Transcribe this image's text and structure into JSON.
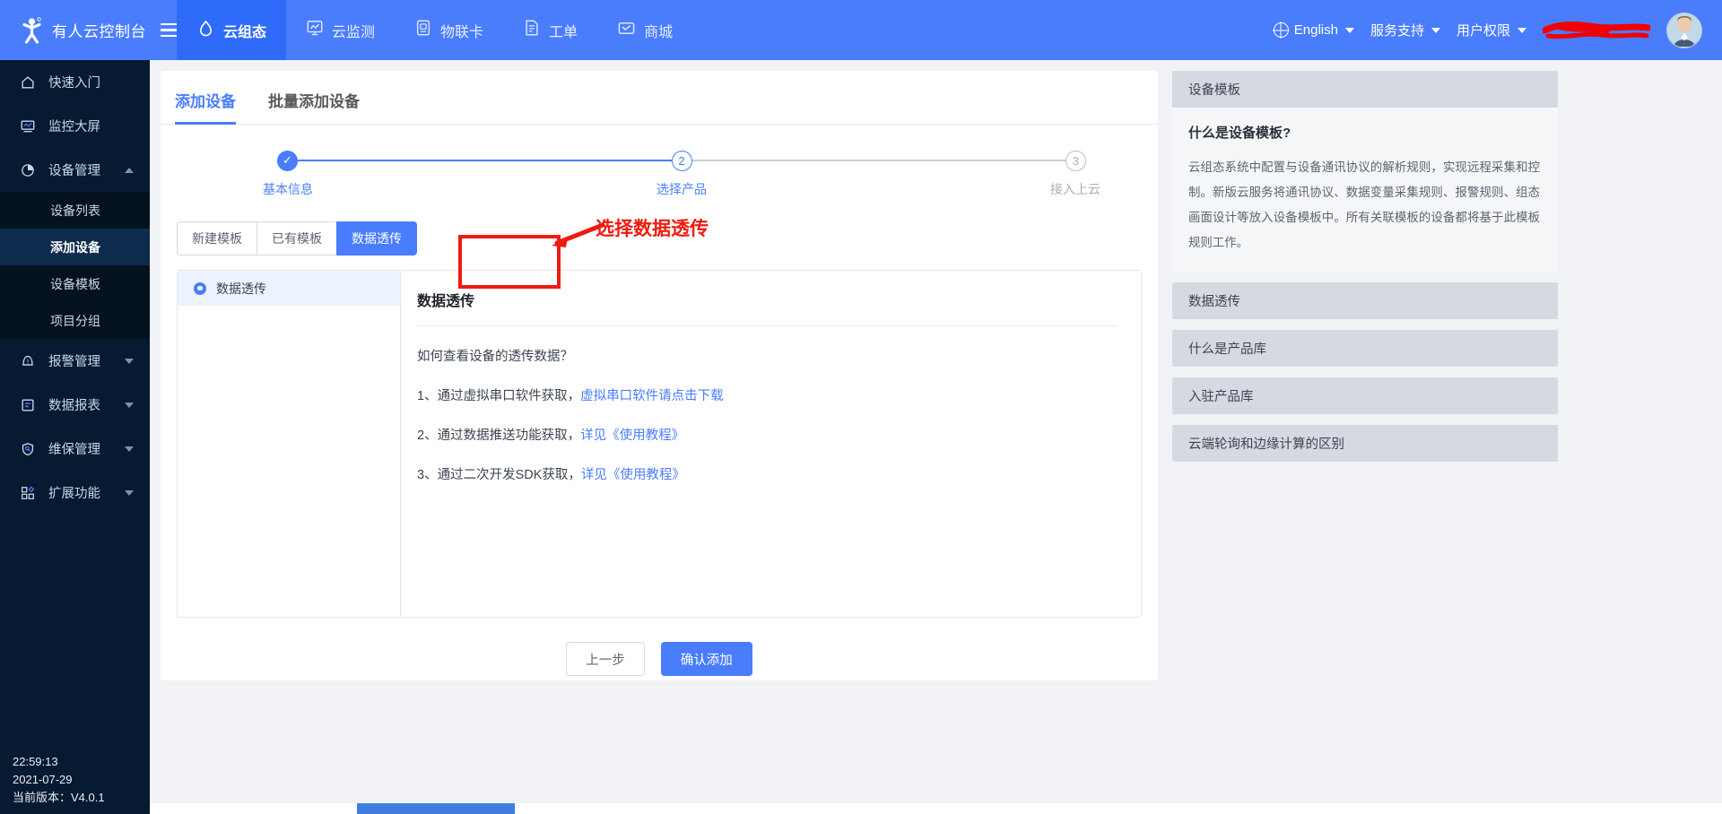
{
  "topbar": {
    "brand_title": "有人云控制台",
    "logo_icon": "person-logo-icon",
    "menu_icon": "hamburger-menu-icon",
    "nav": [
      {
        "label": "云组态",
        "icon": "cloud-icon",
        "active": true
      },
      {
        "label": "云监测",
        "icon": "monitor-chart-icon",
        "active": false
      },
      {
        "label": "物联卡",
        "icon": "sim-card-icon",
        "active": false
      },
      {
        "label": "工单",
        "icon": "ticket-doc-icon",
        "active": false
      },
      {
        "label": "商城",
        "icon": "store-icon",
        "active": false
      }
    ],
    "right": {
      "language": "English",
      "support": "服务支持",
      "permissions": "用户权限",
      "redacted": "",
      "avatar": "user-avatar"
    }
  },
  "sidebar": {
    "items": [
      {
        "label": "快速入门",
        "icon": "home-icon",
        "expandable": false
      },
      {
        "label": "监控大屏",
        "icon": "screen-icon",
        "expandable": false
      },
      {
        "label": "设备管理",
        "icon": "pie-device-icon",
        "expandable": true,
        "expanded": true
      }
    ],
    "sub_items": [
      {
        "label": "设备列表",
        "active": false
      },
      {
        "label": "添加设备",
        "active": true
      },
      {
        "label": "设备模板",
        "active": false
      },
      {
        "label": "项目分组",
        "active": false
      }
    ],
    "items_after": [
      {
        "label": "报警管理",
        "icon": "alarm-bell-icon",
        "expandable": true
      },
      {
        "label": "数据报表",
        "icon": "report-icon",
        "expandable": true
      },
      {
        "label": "维保管理",
        "icon": "shield-wrench-icon",
        "expandable": true
      },
      {
        "label": "扩展功能",
        "icon": "apps-grid-icon",
        "expandable": true
      }
    ],
    "footer": {
      "time": "22:59:13",
      "date": "2021-07-29",
      "version": "当前版本：V4.0.1"
    }
  },
  "page": {
    "tabs": [
      {
        "label": "添加设备",
        "active": true
      },
      {
        "label": "批量添加设备",
        "active": false
      }
    ],
    "steps": [
      {
        "label": "基本信息",
        "marker": "✓",
        "state": "done"
      },
      {
        "label": "选择产品",
        "marker": "2",
        "state": "current"
      },
      {
        "label": "接入上云",
        "marker": "3",
        "state": "todo"
      }
    ],
    "template_tabs": [
      {
        "label": "新建模板",
        "active": false
      },
      {
        "label": "已有模板",
        "active": false
      },
      {
        "label": "数据透传",
        "active": true
      }
    ],
    "panel_left": {
      "item_label": "数据透传",
      "radio_icon": "radio-selected-icon"
    },
    "panel_right": {
      "title": "数据透传",
      "question": "如何查看设备的透传数据？",
      "items": [
        {
          "prefix": "1、通过虚拟串口软件获取，",
          "link": "虚拟串口软件请点击下载"
        },
        {
          "prefix": "2、通过数据推送功能获取，",
          "link": "详见《使用教程》"
        },
        {
          "prefix": "3、通过二次开发SDK获取，",
          "link": "详见《使用教程》"
        }
      ]
    },
    "actions": {
      "prev": "上一步",
      "confirm": "确认添加"
    }
  },
  "help": {
    "header": "设备模板",
    "title": "什么是设备模板?",
    "body": "云组态系统中配置与设备通讯协议的解析规则，实现远程采集和控制。新版云服务将通讯协议、数据变量采集规则、报警规则、组态画面设计等放入设备模板中。所有关联模板的设备都将基于此模板规则工作。",
    "rows": [
      "数据透传",
      "什么是产品库",
      "入驻产品库",
      "云端轮询和边缘计算的区别"
    ]
  },
  "annotation": {
    "text": "选择数据透传",
    "color": "#ee1b11"
  },
  "colors": {
    "brand_blue": "#4a7dfc",
    "topbar_active": "#2f6bf9",
    "sidebar_bg": "#061a31",
    "sidebar_sub_bg": "#04111f",
    "sidebar_active": "#0d2c4d",
    "content_bg": "#f0f2f5",
    "help_header_bg": "#d5d9e2",
    "annotation_red": "#ee1b11"
  }
}
